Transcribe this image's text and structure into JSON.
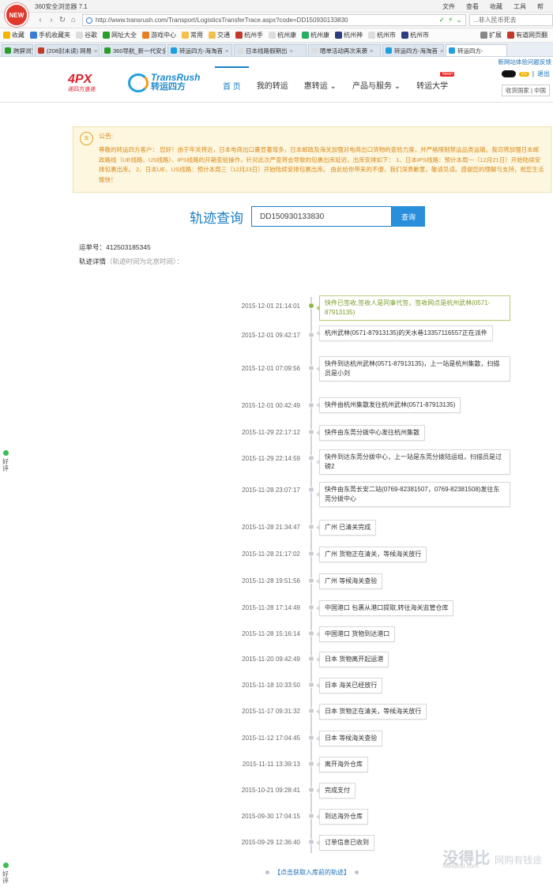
{
  "browser": {
    "logo_text": "NEW",
    "title": "360安全浏览器 7.1",
    "menus": [
      "文件",
      "查看",
      "收藏",
      "工具",
      "帮"
    ],
    "url": "http://www.transrush.com/Transport/LogisticsTransferTrace.aspx?code=DD150930133830",
    "search_text": "...非人民币死去",
    "favorites": [
      "收藏",
      "手机收藏夹",
      "谷歌",
      "网址大全",
      "游戏中心",
      "常用",
      "交通",
      "杭州手",
      "杭州康",
      "杭州康",
      "杭州神",
      "杭州市",
      "杭州市"
    ],
    "fav_right": [
      "扩展",
      "有道网页翻"
    ],
    "tabs": [
      "跨屏浏览",
      "(208封未读) 网易",
      "360导航_新一代安全上网导航",
      "转运四方-海淘首",
      "日本线路假期出",
      "晒单活动再次来袭",
      "转运四方-海淘首",
      "转运四方-"
    ]
  },
  "site": {
    "top_notice": "新网站体验问题反馈",
    "logo_4px": "4PX",
    "logo_4px_sub": "递四方速递",
    "logo_tr_en": "TransRush",
    "logo_tr_cn": "转运四方",
    "nav": [
      {
        "label": "首 页",
        "active": true
      },
      {
        "label": "我的转运"
      },
      {
        "label": "惠转运 ⌄"
      },
      {
        "label": "产品与服务 ⌄"
      },
      {
        "label": "转运大学",
        "badge": "New!"
      }
    ],
    "user": {
      "level": "V5",
      "logout": "退出",
      "country": "收货国家 | 中国"
    }
  },
  "announce": {
    "label": "公告:",
    "text": "尊敬的转运四方客户： 您好！由于年关将近，日本电商出口量显著增多，日本邮政及海关加强对电商出口货物的查验力度，并严格限制禁运品类运输。我司将加强日本邮政路线（UE线路、US线路）、IPS线路的开箱查验操作，针对此次严查将会导致的包裹出库延迟，出库安排如下： 1、日本IPS线路：预计本周一（12月21日）开始陆续安排包裹出库。 2、日本UE、US线路：预计本周三（12月23日）开始陆续安排包裹出库。 由此给你带来的不便，我们深表歉意，敬请见谅。感谢您的理解与支持，祝您生活愉快！"
  },
  "query": {
    "title": "轨迹查询",
    "code": "DD150930133830",
    "button": "查询"
  },
  "waybill": "运单号：412503185345",
  "detail": {
    "label": "轨迹详情",
    "note": "（轨迹时间为北京时间）："
  },
  "timeline": [
    {
      "time": "2015-12-01 21:14:01",
      "text": "快件已签收,签收人是同事代签，签收网点是杭州武林(0571-87913135)",
      "current": true
    },
    {
      "time": "2015-12-01 09:42:17",
      "text": "杭州武林(0571-87913135)的天水巷13357116557正在派件"
    },
    {
      "time": "2015-12-01 07:09:56",
      "text": "快件到达杭州武林(0571-87913135)，上一站是杭州集散，扫描员是小刘"
    },
    {
      "time": "2015-12-01 00:42:49",
      "text": "快件由杭州集散发往杭州武林(0571-87913135)"
    },
    {
      "time": "2015-11-29 22:17:12",
      "text": "快件由东莞分拨中心发往杭州集散"
    },
    {
      "time": "2015-11-29 22:14:59",
      "text": "快件到达东莞分拨中心，上一站是东莞分拨陆运组，扫描员是过磅2"
    },
    {
      "time": "2015-11-28 23:07:17",
      "text": "快件由东莞长安二站(0769-82381507，0769-82381508)发往东莞分拨中心"
    },
    {
      "time": "2015-11-28 21:34:47",
      "text": "广州 已清关完成"
    },
    {
      "time": "2015-11-28 21:17:02",
      "text": "广州 货物正在清关，等候海关放行"
    },
    {
      "time": "2015-11-28 19:51:56",
      "text": "广州 等候海关查验"
    },
    {
      "time": "2015-11-28 17:14:49",
      "text": "中国港口 包裹从港口提取,转往海关监管仓库"
    },
    {
      "time": "2015-11-28 15:16:14",
      "text": "中国港口 货物到达港口"
    },
    {
      "time": "2015-11-20 09:42:49",
      "text": "日本 货物离开起运港"
    },
    {
      "time": "2015-11-18 10:33:50",
      "text": "日本 海关已经放行"
    },
    {
      "time": "2015-11-17 09:31:32",
      "text": "日本 货物正在清关，等候海关放行"
    },
    {
      "time": "2015-11-12 17:04:45",
      "text": "日本 等候海关查验"
    },
    {
      "time": "2015-11-11 13:39:13",
      "text": "离开海外仓库"
    },
    {
      "time": "2015-10-21 09:28:41",
      "text": "完成支付"
    },
    {
      "time": "2015-09-30 17:04:15",
      "text": "到达海外仓库"
    },
    {
      "time": "2015-09-29 12:36:40",
      "text": "订单信息已收到"
    }
  ],
  "more_link": "【点击获取入库前的轨迹】",
  "side_tab": "好评",
  "watermark": {
    "main": "没得比",
    "slogan": "网购有钱途",
    "domain": "Meidebi.com"
  },
  "colors": {
    "accent": "#1a7ec5",
    "notice": "#d9891a",
    "current": "#8fb84a"
  }
}
